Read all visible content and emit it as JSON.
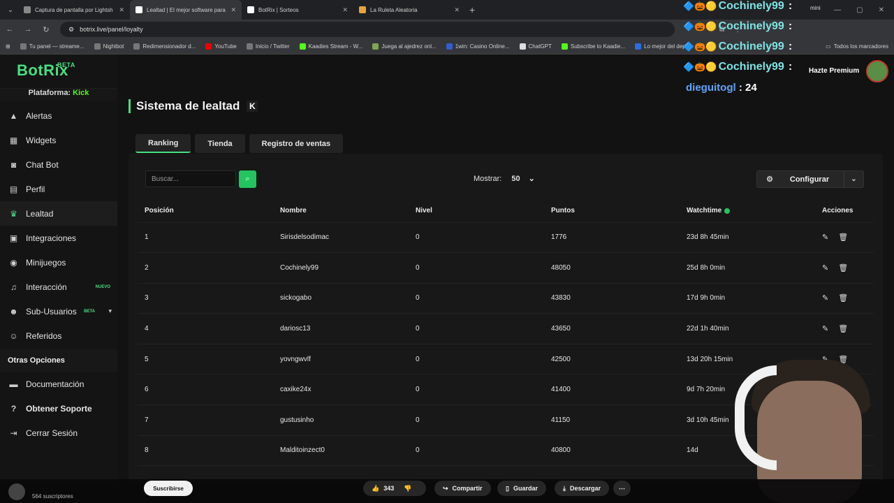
{
  "browser": {
    "tabs": [
      {
        "title": "Captura de pantalla por Lightsh",
        "active": false
      },
      {
        "title": "Lealtad | El mejor software para",
        "active": true
      },
      {
        "title": "BotRix | Sorteos",
        "active": false
      },
      {
        "title": "La Ruleta Aleatoria",
        "active": false
      }
    ],
    "url": "botrix.live/panel/loyalty",
    "bookmarks": [
      "Tu panel — streame...",
      "Nightbot",
      "Redimensionador d...",
      "YouTube",
      "Inicio / Twitter",
      "Kaadies Stream - W...",
      "Juega al ajedrez onl...",
      "1win: Casino Online...",
      "ChatGPT",
      "Subscribe to Kaadie...",
      "Lo mejor del dep..."
    ],
    "all_bookmarks": "Todos los marcadores"
  },
  "sidebar": {
    "logo": "BotRix",
    "logo_tag": "BETA",
    "platform_label": "Plataforma:",
    "platform_value": "Kick",
    "items": [
      {
        "label": "Alertas",
        "icon": "warning-icon"
      },
      {
        "label": "Widgets",
        "icon": "grid-icon"
      },
      {
        "label": "Chat Bot",
        "icon": "robot-icon"
      },
      {
        "label": "Perfil",
        "icon": "id-card-icon"
      },
      {
        "label": "Lealtad",
        "icon": "trophy-icon"
      },
      {
        "label": "Integraciones",
        "icon": "plug-icon"
      },
      {
        "label": "Minijuegos",
        "icon": "gamepad-icon"
      },
      {
        "label": "Interacción",
        "icon": "music-icon",
        "badge": "NUEVO"
      },
      {
        "label": "Sub-Usuarios",
        "icon": "users-icon",
        "badge": "BETA"
      },
      {
        "label": "Referidos",
        "icon": "user-plus-icon"
      }
    ],
    "section_title": "Otras Opciones",
    "other_items": [
      {
        "label": "Documentación",
        "icon": "doc-icon"
      },
      {
        "label": "Obtener Soporte",
        "icon": "help-icon"
      },
      {
        "label": "Cerrar Sesión",
        "icon": "logout-icon"
      }
    ]
  },
  "main": {
    "title": "Sistema de lealtad",
    "tabs": [
      "Ranking",
      "Tienda",
      "Registro de ventas"
    ],
    "search_placeholder": "Buscar...",
    "show_label": "Mostrar:",
    "show_value": "50",
    "config_label": "Configurar",
    "columns": [
      "Posición",
      "Nombre",
      "Nivel",
      "Puntos",
      "Watchtime",
      "Acciones"
    ],
    "rows": [
      {
        "pos": "1",
        "name": "Sirisdelsodimac",
        "level": "0",
        "points": "1776",
        "watch": "23d 8h 45min"
      },
      {
        "pos": "2",
        "name": "Cochinely99",
        "level": "0",
        "points": "48050",
        "watch": "25d 8h 0min"
      },
      {
        "pos": "3",
        "name": "sickogabo",
        "level": "0",
        "points": "43830",
        "watch": "17d 9h 0min"
      },
      {
        "pos": "4",
        "name": "dariosc13",
        "level": "0",
        "points": "43650",
        "watch": "22d 1h 40min"
      },
      {
        "pos": "5",
        "name": "yovngwvlf",
        "level": "0",
        "points": "42500",
        "watch": "13d 20h 15min"
      },
      {
        "pos": "6",
        "name": "caxike24x",
        "level": "0",
        "points": "41400",
        "watch": "9d 7h 20min"
      },
      {
        "pos": "7",
        "name": "gustusinho",
        "level": "0",
        "points": "41150",
        "watch": "3d 10h 45min"
      },
      {
        "pos": "8",
        "name": "Malditoinzect0",
        "level": "0",
        "points": "40800",
        "watch": "14d"
      }
    ]
  },
  "overlay": {
    "chat_user": "Cochinely99",
    "chat_colon": ":",
    "chat_repeat": 4,
    "chat2_user": "dieguitogl",
    "chat2_value": ": 24",
    "premium": "Hazte Premium",
    "mini": "mini"
  },
  "youtube": {
    "subscribers": "564 suscriptores",
    "subscribe": "Suscribirse",
    "likes": "343",
    "share": "Compartir",
    "save": "Guardar",
    "download": "Descargar"
  },
  "colors": {
    "accent": "#4ade80",
    "kick": "#53fc18",
    "bg": "#121212"
  }
}
